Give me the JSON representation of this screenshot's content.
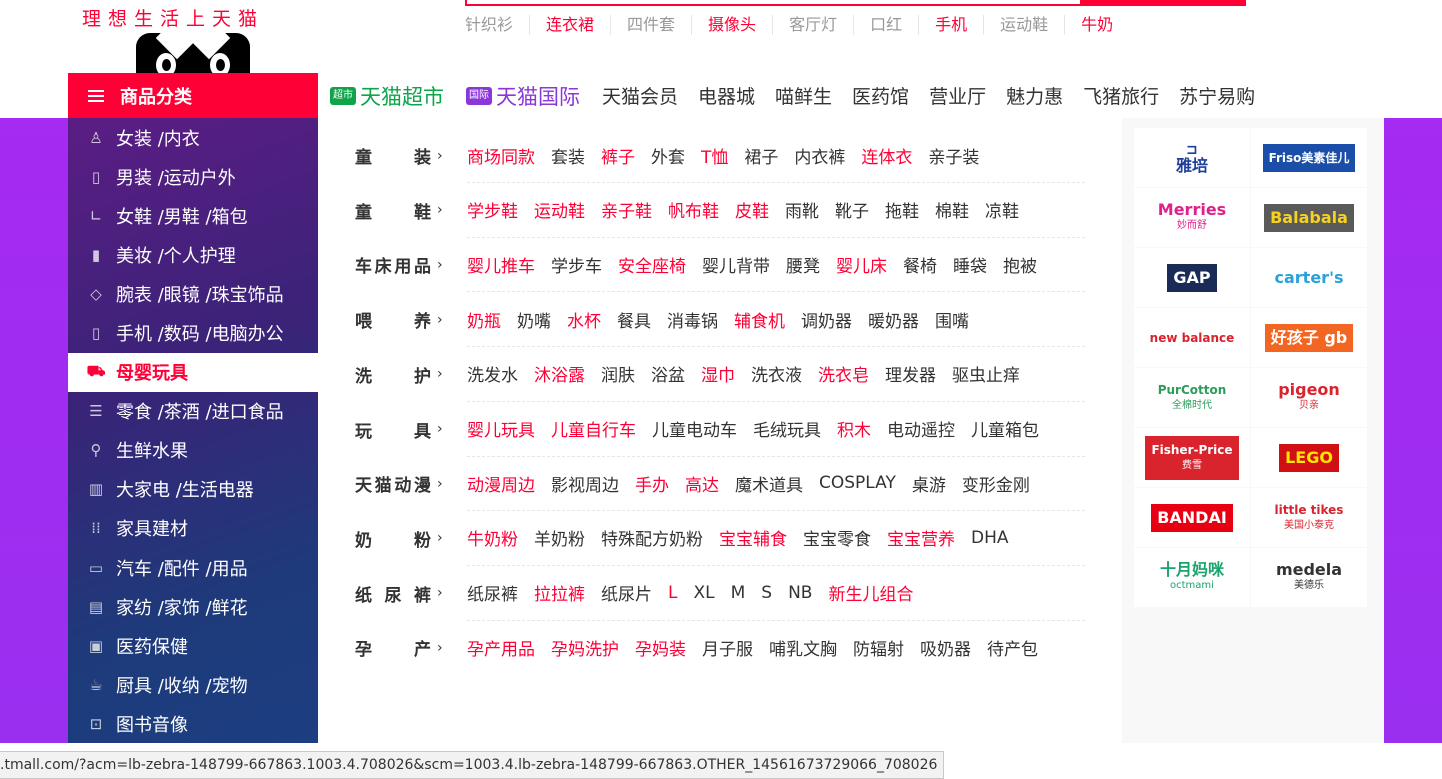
{
  "logo": {
    "text": "理想生活上天猫"
  },
  "hot_words": [
    {
      "label": "针织衫",
      "red": false
    },
    {
      "label": "连衣裙",
      "red": true
    },
    {
      "label": "四件套",
      "red": false
    },
    {
      "label": "摄像头",
      "red": true
    },
    {
      "label": "客厅灯",
      "red": false
    },
    {
      "label": "口红",
      "red": false
    },
    {
      "label": "手机",
      "red": true
    },
    {
      "label": "运动鞋",
      "red": false
    },
    {
      "label": "牛奶",
      "red": true
    }
  ],
  "category_button": {
    "label": "商品分类"
  },
  "topnav": {
    "chaoshi": {
      "badge": "超市",
      "label": "天猫超市"
    },
    "guoji": {
      "badge": "国际",
      "label": "天猫国际"
    },
    "items": [
      "天猫会员",
      "电器城",
      "喵鲜生",
      "医药馆",
      "营业厅",
      "魅力惠",
      "飞猪旅行",
      "苏宁易购"
    ]
  },
  "sidebar": {
    "items": [
      {
        "label": "女装 /内衣",
        "icon": "dress-icon",
        "glyph": "♙"
      },
      {
        "label": "男装 /运动户外",
        "icon": "shirt-icon",
        "glyph": "▯"
      },
      {
        "label": "女鞋 /男鞋 /箱包",
        "icon": "boot-icon",
        "glyph": "∟"
      },
      {
        "label": "美妆 /个人护理",
        "icon": "lipstick-icon",
        "glyph": "▮"
      },
      {
        "label": "腕表 /眼镜 /珠宝饰品",
        "icon": "diamond-icon",
        "glyph": "◇"
      },
      {
        "label": "手机 /数码 /电脑办公",
        "icon": "phone-icon",
        "glyph": "▯"
      },
      {
        "label": "母婴玩具",
        "icon": "stroller-icon",
        "glyph": "⛟",
        "active": true
      },
      {
        "label": "零食 /茶酒 /进口食品",
        "icon": "snack-icon",
        "glyph": "☰"
      },
      {
        "label": "生鲜水果",
        "icon": "bicycle-icon",
        "glyph": "⚲"
      },
      {
        "label": "大家电 /生活电器",
        "icon": "fridge-icon",
        "glyph": "▥"
      },
      {
        "label": "家具建材",
        "icon": "grid-icon",
        "glyph": "⁞⁞"
      },
      {
        "label": "汽车 /配件 /用品",
        "icon": "car-icon",
        "glyph": "▭"
      },
      {
        "label": "家纺 /家饰 /鲜花",
        "icon": "sofa-icon",
        "glyph": "▤"
      },
      {
        "label": "医药保健",
        "icon": "medicine-icon",
        "glyph": "▣"
      },
      {
        "label": "厨具 /收纳 /宠物",
        "icon": "cup-icon",
        "glyph": "☕"
      },
      {
        "label": "图书音像",
        "icon": "lock-icon",
        "glyph": "⊡"
      }
    ]
  },
  "panel": {
    "rows": [
      {
        "title": "童装",
        "links": [
          {
            "t": "商场同款",
            "r": true
          },
          {
            "t": "套装",
            "r": false
          },
          {
            "t": "裤子",
            "r": true
          },
          {
            "t": "外套",
            "r": false
          },
          {
            "t": "T恤",
            "r": true
          },
          {
            "t": "裙子",
            "r": false
          },
          {
            "t": "内衣裤",
            "r": false
          },
          {
            "t": "连体衣",
            "r": true
          },
          {
            "t": "亲子装",
            "r": false
          }
        ]
      },
      {
        "title": "童鞋",
        "links": [
          {
            "t": "学步鞋",
            "r": true
          },
          {
            "t": "运动鞋",
            "r": true
          },
          {
            "t": "亲子鞋",
            "r": true
          },
          {
            "t": "帆布鞋",
            "r": true
          },
          {
            "t": "皮鞋",
            "r": true
          },
          {
            "t": "雨靴",
            "r": false
          },
          {
            "t": "靴子",
            "r": false
          },
          {
            "t": "拖鞋",
            "r": false
          },
          {
            "t": "棉鞋",
            "r": false
          },
          {
            "t": "凉鞋",
            "r": false
          }
        ]
      },
      {
        "title": "车床用品",
        "links": [
          {
            "t": "婴儿推车",
            "r": true
          },
          {
            "t": "学步车",
            "r": false
          },
          {
            "t": "安全座椅",
            "r": true
          },
          {
            "t": "婴儿背带",
            "r": false
          },
          {
            "t": "腰凳",
            "r": false
          },
          {
            "t": "婴儿床",
            "r": true
          },
          {
            "t": "餐椅",
            "r": false
          },
          {
            "t": "睡袋",
            "r": false
          },
          {
            "t": "抱被",
            "r": false
          }
        ]
      },
      {
        "title": "喂养",
        "links": [
          {
            "t": "奶瓶",
            "r": true
          },
          {
            "t": "奶嘴",
            "r": false
          },
          {
            "t": "水杯",
            "r": true
          },
          {
            "t": "餐具",
            "r": false
          },
          {
            "t": "消毒锅",
            "r": false
          },
          {
            "t": "辅食机",
            "r": true
          },
          {
            "t": "调奶器",
            "r": false
          },
          {
            "t": "暖奶器",
            "r": false
          },
          {
            "t": "围嘴",
            "r": false
          }
        ]
      },
      {
        "title": "洗护",
        "links": [
          {
            "t": "洗发水",
            "r": false
          },
          {
            "t": "沐浴露",
            "r": true
          },
          {
            "t": "润肤",
            "r": false
          },
          {
            "t": "浴盆",
            "r": false
          },
          {
            "t": "湿巾",
            "r": true
          },
          {
            "t": "洗衣液",
            "r": false
          },
          {
            "t": "洗衣皂",
            "r": true
          },
          {
            "t": "理发器",
            "r": false
          },
          {
            "t": "驱虫止痒",
            "r": false
          }
        ]
      },
      {
        "title": "玩具",
        "links": [
          {
            "t": "婴儿玩具",
            "r": true
          },
          {
            "t": "儿童自行车",
            "r": true
          },
          {
            "t": "儿童电动车",
            "r": false
          },
          {
            "t": "毛绒玩具",
            "r": false
          },
          {
            "t": "积木",
            "r": true
          },
          {
            "t": "电动遥控",
            "r": false
          },
          {
            "t": "儿童箱包",
            "r": false
          }
        ]
      },
      {
        "title": "天猫动漫",
        "links": [
          {
            "t": "动漫周边",
            "r": true
          },
          {
            "t": "影视周边",
            "r": false
          },
          {
            "t": "手办",
            "r": true
          },
          {
            "t": "高达",
            "r": true
          },
          {
            "t": "魔术道具",
            "r": false
          },
          {
            "t": "COSPLAY",
            "r": false
          },
          {
            "t": "桌游",
            "r": false
          },
          {
            "t": "变形金刚",
            "r": false
          }
        ]
      },
      {
        "title": "奶粉",
        "links": [
          {
            "t": "牛奶粉",
            "r": true
          },
          {
            "t": "羊奶粉",
            "r": false
          },
          {
            "t": "特殊配方奶粉",
            "r": false
          },
          {
            "t": "宝宝辅食",
            "r": true
          },
          {
            "t": "宝宝零食",
            "r": false
          },
          {
            "t": "宝宝营养",
            "r": true
          },
          {
            "t": "DHA",
            "r": false
          }
        ]
      },
      {
        "title": "纸尿裤",
        "links": [
          {
            "t": "纸尿裤",
            "r": false
          },
          {
            "t": "拉拉裤",
            "r": true
          },
          {
            "t": "纸尿片",
            "r": false
          },
          {
            "t": "L",
            "r": true
          },
          {
            "t": "XL",
            "r": false
          },
          {
            "t": "M",
            "r": false
          },
          {
            "t": "S",
            "r": false
          },
          {
            "t": "NB",
            "r": false
          },
          {
            "t": "新生儿组合",
            "r": true
          }
        ]
      },
      {
        "title": "孕产",
        "links": [
          {
            "t": "孕产用品",
            "r": true
          },
          {
            "t": "孕妈洗护",
            "r": true
          },
          {
            "t": "孕妈装",
            "r": true
          },
          {
            "t": "月子服",
            "r": false
          },
          {
            "t": "哺乳文胸",
            "r": false
          },
          {
            "t": "防辐射",
            "r": false
          },
          {
            "t": "吸奶器",
            "r": false
          },
          {
            "t": "待产包",
            "r": false
          }
        ]
      }
    ]
  },
  "brands": [
    {
      "name": "雅培",
      "prefix": "⊐",
      "color": "#1d3f99",
      "bg": "#ffffff"
    },
    {
      "name": "Friso美素佳儿",
      "color": "#ffffff",
      "bg": "#1a4ea8"
    },
    {
      "name": "Merries",
      "sub": "妙而舒",
      "color": "#e0218a",
      "bg": "#ffffff"
    },
    {
      "name": "Balabala",
      "color": "#f7d11a",
      "bg": "#5a5a5a"
    },
    {
      "name": "GAP",
      "color": "#ffffff",
      "bg": "#1b2b57"
    },
    {
      "name": "carter's",
      "color": "#2aa1d9",
      "bg": "#ffffff"
    },
    {
      "name": "new balance",
      "color": "#d9232d",
      "bg": "#ffffff"
    },
    {
      "name": "好孩子 gb",
      "color": "#ffffff",
      "bg": "#f26522"
    },
    {
      "name": "PurCotton",
      "sub": "全棉时代",
      "color": "#2a9d5c",
      "bg": "#ffffff"
    },
    {
      "name": "pigeon",
      "sub": "贝亲",
      "color": "#d9232d",
      "bg": "#ffffff"
    },
    {
      "name": "Fisher-Price",
      "sub": "费雪",
      "color": "#ffffff",
      "bg": "#d9232d"
    },
    {
      "name": "LEGO",
      "color": "#ffe600",
      "bg": "#d01012"
    },
    {
      "name": "BANDAI",
      "color": "#ffffff",
      "bg": "#e60012"
    },
    {
      "name": "little tikes",
      "sub": "美国小泰克",
      "color": "#d9232d",
      "bg": "#ffffff"
    },
    {
      "name": "十月妈咪",
      "sub": "octmami",
      "color": "#1aa36b",
      "bg": "#ffffff"
    },
    {
      "name": "medela",
      "sub": "美德乐",
      "color": "#333333",
      "bg": "#ffffff"
    }
  ],
  "status_bar": {
    "url": ".tmall.com/?acm=lb-zebra-148799-667863.1003.4.708026&scm=1003.4.lb-zebra-148799-667863.OTHER_14561673729066_708026"
  },
  "colors": {
    "accent": "#ff0036",
    "sidebar_dark": "#2a2a7a",
    "banner_purple": "#a52af2"
  }
}
